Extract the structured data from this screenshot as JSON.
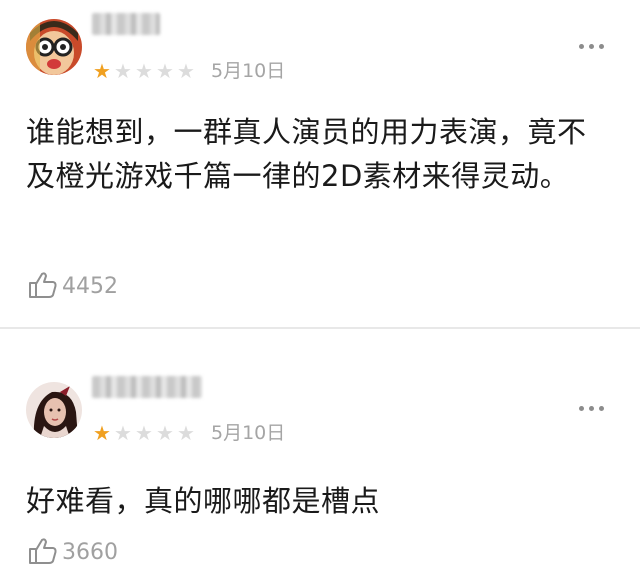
{
  "reviews": [
    {
      "rating": 1,
      "max_rating": 5,
      "date": "5月10日",
      "content": "谁能想到，一群真人演员的用力表演，竟不及橙光游戏千篇一律的2D素材来得灵动。",
      "likes": "4452"
    },
    {
      "rating": 1,
      "max_rating": 5,
      "date": "5月10日",
      "content": "好难看，真的哪哪都是槽点",
      "likes": "3660"
    }
  ],
  "colors": {
    "star_active": "#f0a020",
    "star_inactive": "#dcdcdc",
    "muted_text": "#a5a5a5"
  }
}
